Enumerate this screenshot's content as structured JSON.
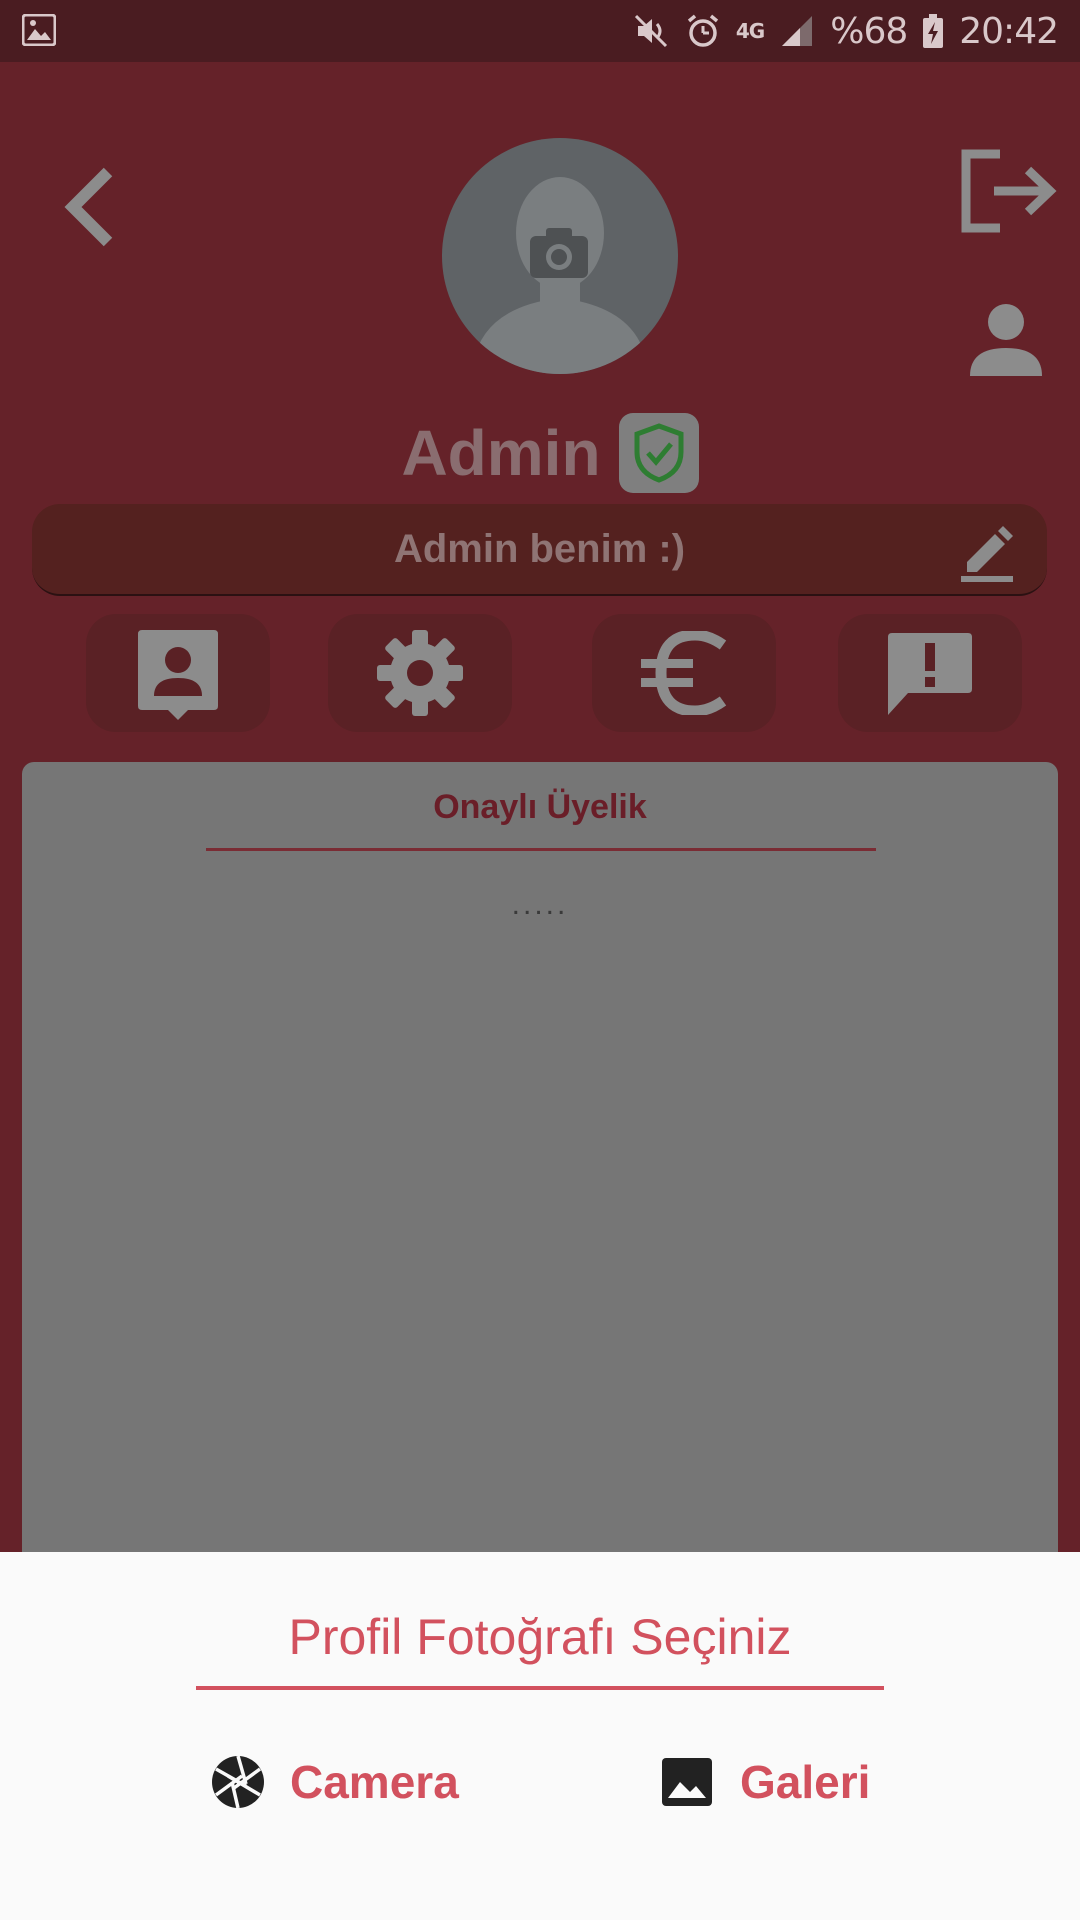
{
  "status_bar": {
    "battery_text": "%68",
    "network_text": "4G",
    "time": "20:42"
  },
  "profile": {
    "name": "Admin",
    "status_message": "Admin benim :)"
  },
  "card": {
    "title": "Onaylı Üyelik",
    "content": "....."
  },
  "sheet": {
    "title": "Profil Fotoğrafı Seçiniz",
    "camera_label": "Camera",
    "gallery_label": "Galeri"
  },
  "colors": {
    "background": "#652229",
    "status_bar": "#4a1c21",
    "accent": "#d2515e",
    "card": "#767676",
    "sheet": "#fafafa",
    "verified": "#2e7d32"
  },
  "icons": {
    "status_left": "image-icon",
    "mute": "mute-icon",
    "alarm": "alarm-icon",
    "signal": "signal-icon",
    "battery": "battery-charging-icon",
    "back": "chevron-left-icon",
    "logout": "logout-icon",
    "person": "person-icon",
    "camera_overlay": "camera-icon",
    "verified": "shield-check-icon",
    "edit": "pencil-icon",
    "contact": "contact-card-icon",
    "settings": "gear-icon",
    "currency": "euro-icon",
    "report": "feedback-icon",
    "camera_option": "aperture-icon",
    "gallery_option": "image-icon"
  }
}
